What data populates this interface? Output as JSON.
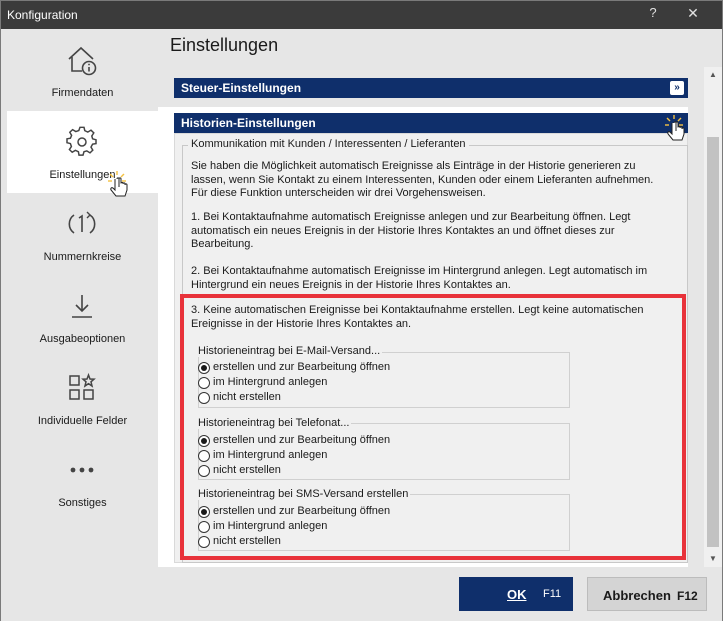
{
  "window": {
    "title": "Konfiguration",
    "help": "?",
    "close": "✕"
  },
  "sidebar": {
    "items": [
      {
        "label": "Firmendaten",
        "icon": "home-info-icon",
        "active": false
      },
      {
        "label": "Einstellungen",
        "icon": "gear-icon",
        "active": true
      },
      {
        "label": "Nummernkreise",
        "icon": "cycle-number-icon",
        "active": false
      },
      {
        "label": "Ausgabeoptionen",
        "icon": "download-icon",
        "active": false
      },
      {
        "label": "Individuelle Felder",
        "icon": "grid-star-icon",
        "active": false
      },
      {
        "label": "Sonstiges",
        "icon": "more-dots-icon",
        "active": false
      }
    ]
  },
  "main": {
    "title": "Einstellungen",
    "sections": [
      {
        "label": "Steuer-Einstellungen",
        "expanded": false
      },
      {
        "label": "Historien-Einstellungen",
        "expanded": true
      }
    ]
  },
  "historien": {
    "group_title": "Kommunikation mit Kunden / Interessenten / Lieferanten",
    "intro": "Sie haben die Möglichkeit automatisch Ereignisse als Einträge in der Historie generieren zu lassen, wenn Sie Kontakt zu einem Interessenten, Kunden oder einem Lieferanten aufnehmen. Für diese Funktion unterscheiden wir drei Vorgehensweisen.",
    "option1": "1. Bei Kontaktaufnahme automatisch Ereignisse anlegen und zur Bearbeitung öffnen. Legt automatisch ein neues Ereignis in der Historie Ihres Kontaktes an und öffnet dieses zur Bearbeitung.",
    "option2": "2. Bei Kontaktaufnahme automatisch Ereignisse im Hintergrund anlegen. Legt automatisch im Hintergrund ein neues Ereignis in der Historie Ihres Kontaktes an.",
    "option3": "3. Keine automatischen Ereignisse bei Kontaktaufnahme erstellen. Legt keine automatischen Ereignisse in der Historie Ihres Kontaktes an.",
    "groups": [
      {
        "title": "Historieneintrag bei E-Mail-Versand...",
        "options": [
          "erstellen und zur Bearbeitung öffnen",
          "im Hintergrund anlegen",
          "nicht erstellen"
        ],
        "selected": 0
      },
      {
        "title": "Historieneintrag bei Telefonat...",
        "options": [
          "erstellen und zur Bearbeitung öffnen",
          "im Hintergrund anlegen",
          "nicht erstellen"
        ],
        "selected": 0
      },
      {
        "title": "Historieneintrag bei SMS-Versand erstellen",
        "options": [
          "erstellen und zur Bearbeitung öffnen",
          "im Hintergrund anlegen",
          "nicht erstellen"
        ],
        "selected": 0
      }
    ]
  },
  "footer": {
    "ok_label": "OK",
    "ok_key": "F11",
    "cancel_label": "Abbrechen",
    "cancel_key": "F12"
  },
  "colors": {
    "accent": "#0f2f6b",
    "highlight": "#e8323a",
    "titlebar": "#3b3b3b"
  }
}
